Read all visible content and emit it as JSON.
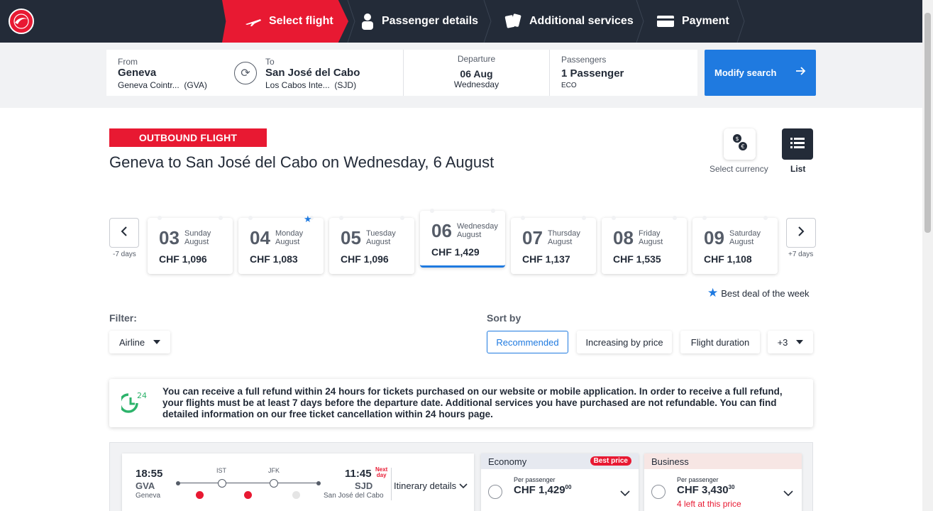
{
  "nav": {
    "steps": [
      {
        "label": "Select flight",
        "icon": "plane-icon"
      },
      {
        "label": "Passenger details",
        "icon": "person-icon"
      },
      {
        "label": "Additional services",
        "icon": "cards-icon"
      },
      {
        "label": "Payment",
        "icon": "card-icon"
      }
    ]
  },
  "search": {
    "from_label": "From",
    "from_city": "Geneva",
    "from_airport": "Geneva Cointr...",
    "from_code": "(GVA)",
    "to_label": "To",
    "to_city": "San José del Cabo",
    "to_airport": "Los Cabos Inte...",
    "to_code": "(SJD)",
    "departure_label": "Departure",
    "departure_date": "06 Aug",
    "departure_day": "Wednesday",
    "passengers_label": "Passengers",
    "passengers_value": "1 Passenger",
    "cabin": "ECO",
    "modify_label": "Modify search"
  },
  "heading": {
    "badge": "OUTBOUND FLIGHT",
    "title": "Geneva to San José del Cabo on Wednesday, 6 August",
    "currency_label": "Select currency",
    "list_label": "List"
  },
  "dates": {
    "prev_label": "-7 days",
    "next_label": "+7 days",
    "days": [
      {
        "num": "03",
        "name": "Sunday",
        "month": "August",
        "price": "CHF 1,096"
      },
      {
        "num": "04",
        "name": "Monday",
        "month": "August",
        "price": "CHF 1,083"
      },
      {
        "num": "05",
        "name": "Tuesday",
        "month": "August",
        "price": "CHF 1,096"
      },
      {
        "num": "06",
        "name": "Wednesday",
        "month": "August",
        "price": "CHF 1,429"
      },
      {
        "num": "07",
        "name": "Thursday",
        "month": "August",
        "price": "CHF 1,137"
      },
      {
        "num": "08",
        "name": "Friday",
        "month": "August",
        "price": "CHF 1,535"
      },
      {
        "num": "09",
        "name": "Saturday",
        "month": "August",
        "price": "CHF 1,108"
      }
    ],
    "selected_index": 3,
    "best_index": 1,
    "best_deal_label": "Best deal of the week"
  },
  "filter": {
    "label": "Filter:",
    "airline": "Airline"
  },
  "sort": {
    "label": "Sort by",
    "options": [
      "Recommended",
      "Increasing by price",
      "Flight duration",
      "+3"
    ],
    "active": "Recommended"
  },
  "refund_notice": "You can receive a full refund within 24 hours for tickets purchased on our website or mobile application. In order to receive a full refund, your flights must be at least 7 days before the departure date. Additional services you have purchased are not refundable. You can find detailed information on our free ticket cancellation within 24 hours page.",
  "refund_icon_text": "24",
  "flight": {
    "dep_time": "18:55",
    "dep_code": "GVA",
    "dep_city": "Geneva",
    "arr_time": "11:45",
    "arr_code": "SJD",
    "arr_city": "San José del Cabo",
    "next_day_line1": "Next",
    "next_day_line2": "day",
    "stops": [
      "IST",
      "JFK"
    ],
    "itinerary_label": "Itinerary details"
  },
  "fares": {
    "economy": {
      "label": "Economy",
      "badge": "Best price",
      "per": "Per passenger",
      "price": "CHF 1,429",
      "cents": "00"
    },
    "business": {
      "label": "Business",
      "per": "Per passenger",
      "price": "CHF 3,430",
      "cents": "30",
      "left": "4 left at this price"
    }
  },
  "colors": {
    "brand_red": "#e81932",
    "navy": "#232b38",
    "blue": "#1f7ae0"
  }
}
